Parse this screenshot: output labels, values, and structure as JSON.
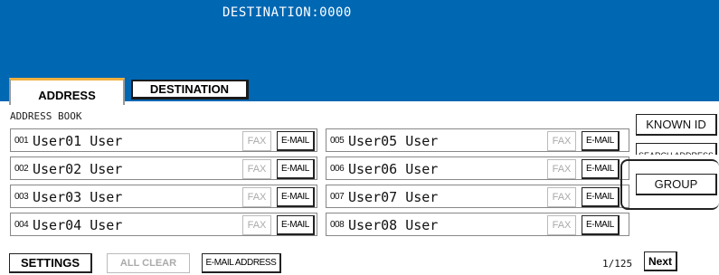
{
  "header": {
    "destination_text": "DESTINATION:0000"
  },
  "tabs": [
    {
      "label": "ADDRESS",
      "active": true
    },
    {
      "label": "DESTINATION",
      "active": false
    }
  ],
  "address_book_label": "ADDRESS BOOK",
  "entries": [
    {
      "number": "001",
      "name": "User01 User",
      "fax_label": "FAX",
      "email_label": "E-MAIL"
    },
    {
      "number": "002",
      "name": "User02 User",
      "fax_label": "FAX",
      "email_label": "E-MAIL"
    },
    {
      "number": "003",
      "name": "User03 User",
      "fax_label": "FAX",
      "email_label": "E-MAIL"
    },
    {
      "number": "004",
      "name": "User04 User",
      "fax_label": "FAX",
      "email_label": "E-MAIL"
    },
    {
      "number": "005",
      "name": "User05 User",
      "fax_label": "FAX",
      "email_label": "E-MAIL"
    },
    {
      "number": "006",
      "name": "User06 User",
      "fax_label": "FAX",
      "email_label": "E-MAIL"
    },
    {
      "number": "007",
      "name": "User07 User",
      "fax_label": "FAX",
      "email_label": "E-MAIL"
    },
    {
      "number": "008",
      "name": "User08 User",
      "fax_label": "FAX",
      "email_label": "E-MAIL"
    }
  ],
  "side_buttons": {
    "known_id": "KNOWN ID",
    "search_address": "SEARCH ADDRESS",
    "group": "GROUP"
  },
  "bottom": {
    "settings": "SETTINGS",
    "all_clear": "ALL CLEAR",
    "email_address": "E-MAIL ADDRESS",
    "page_indicator": "1/125",
    "next": "Next"
  },
  "colors": {
    "header_blue": "#0067b3",
    "tab_accent": "#f0b040",
    "disabled_text": "#aaaaaa"
  }
}
